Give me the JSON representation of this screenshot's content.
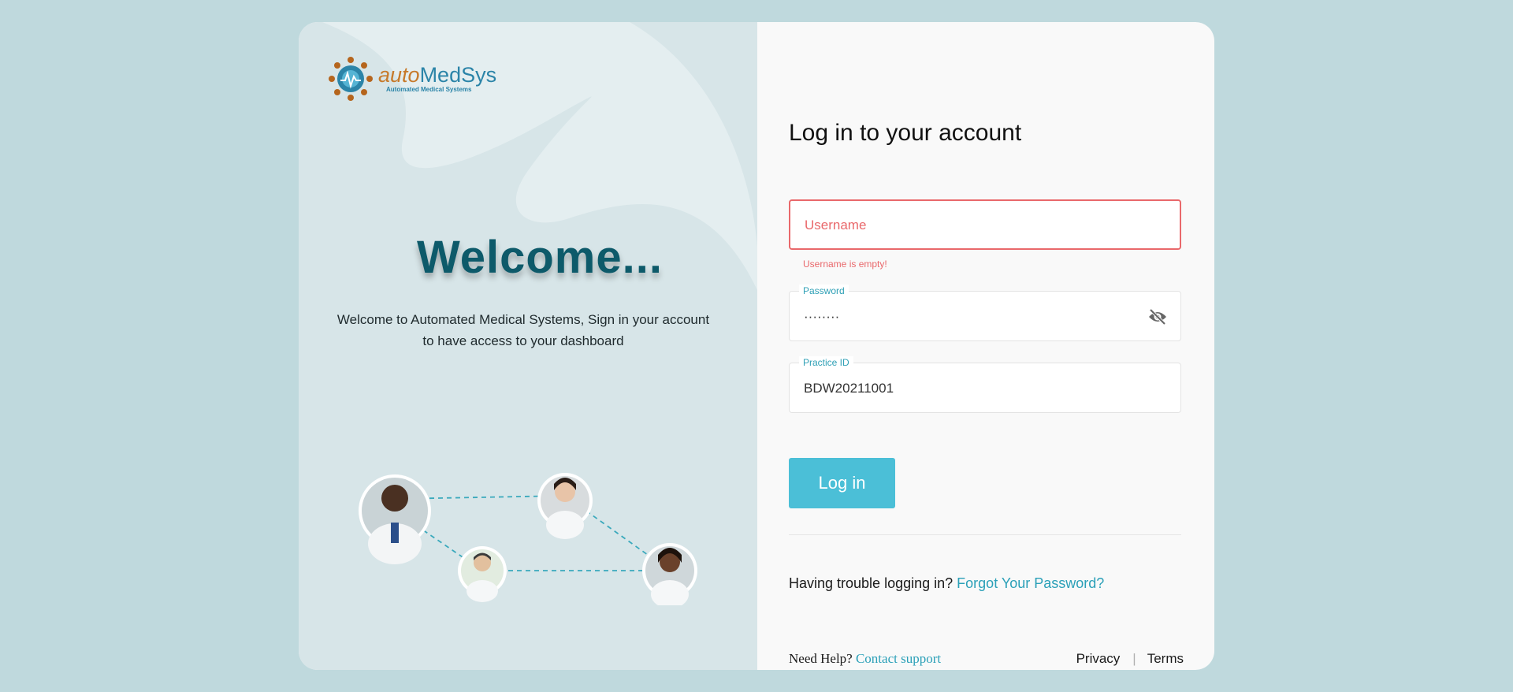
{
  "brand": {
    "logo_auto": "auto",
    "logo_medsys": "MedSys",
    "logo_tagline": "Automated Medical Systems",
    "colors": {
      "primary": "#4bbfd7",
      "dark": "#0d5a6a",
      "error": "#e9686b",
      "link": "#2ba0b8"
    }
  },
  "welcome": {
    "title": "Welcome...",
    "description": "Welcome to Automated Medical Systems, Sign in your account to have access to your dashboard"
  },
  "form": {
    "title": "Log in to your account",
    "username": {
      "placeholder": "Username",
      "value": "",
      "error": "Username is empty!"
    },
    "password": {
      "label": "Password",
      "value": "········",
      "toggle_icon": "eye-off-icon"
    },
    "practice_id": {
      "label": "Practice ID",
      "value": "BDW20211001"
    },
    "login_button": "Log in",
    "trouble_text": "Having trouble logging in?",
    "forgot_link": "Forgot Your Password?"
  },
  "footer": {
    "help_text": "Need Help?",
    "contact_link": "Contact support",
    "privacy": "Privacy",
    "separator": "|",
    "terms": "Terms"
  }
}
